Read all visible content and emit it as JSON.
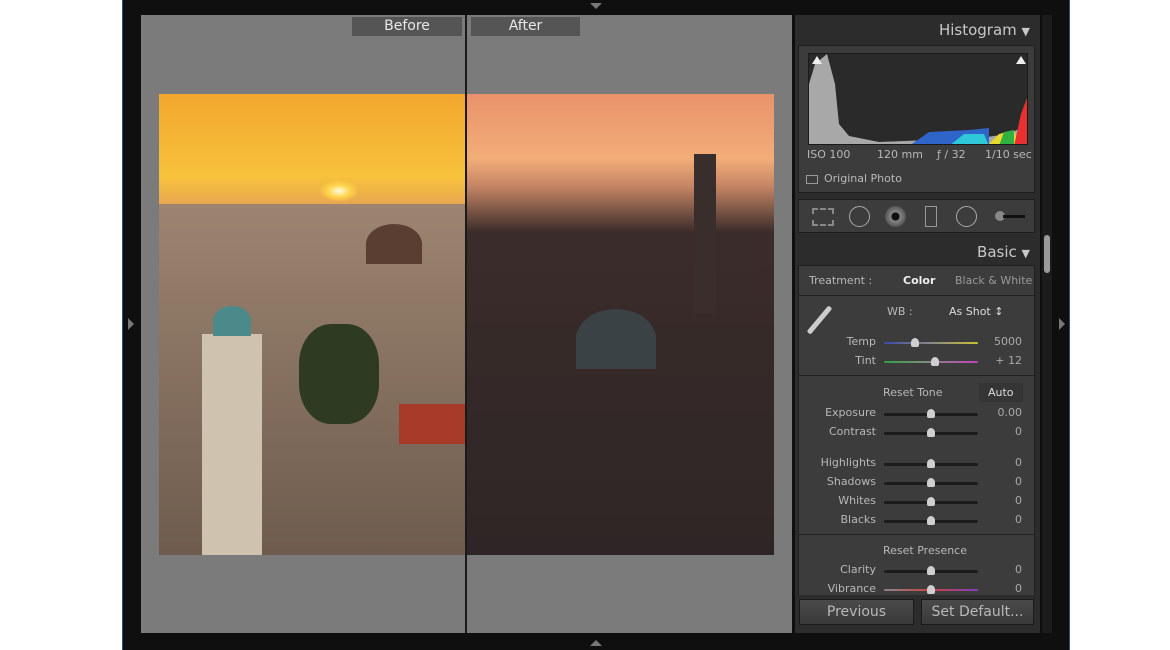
{
  "compare": {
    "before_label": "Before",
    "after_label": "After"
  },
  "histogram": {
    "title": "Histogram",
    "iso": "ISO 100",
    "focal": "120 mm",
    "aperture": "ƒ / 32",
    "shutter": "1/10 sec",
    "original_photo_label": "Original Photo",
    "original_photo_checked": false
  },
  "tools": [
    "crop-overlay",
    "spot-removal",
    "red-eye",
    "graduated-filter",
    "radial-filter",
    "adjustment-brush"
  ],
  "basic": {
    "title": "Basic",
    "treatment_label": "Treatment :",
    "treatment_color": "Color",
    "treatment_bw": "Black & White",
    "wb_label": "WB :",
    "wb_value": "As Shot ↕",
    "reset_tone": "Reset Tone",
    "auto": "Auto",
    "reset_presence": "Reset Presence",
    "sliders": [
      {
        "name": "Temp",
        "value": "5000",
        "pos": 0.33
      },
      {
        "name": "Tint",
        "value": "+ 12",
        "pos": 0.54
      },
      {
        "name": "Exposure",
        "value": "0.00",
        "pos": 0.5
      },
      {
        "name": "Contrast",
        "value": "0",
        "pos": 0.5
      },
      {
        "name": "Highlights",
        "value": "0",
        "pos": 0.5
      },
      {
        "name": "Shadows",
        "value": "0",
        "pos": 0.5
      },
      {
        "name": "Whites",
        "value": "0",
        "pos": 0.5
      },
      {
        "name": "Blacks",
        "value": "0",
        "pos": 0.5
      },
      {
        "name": "Clarity",
        "value": "0",
        "pos": 0.5
      },
      {
        "name": "Vibrance",
        "value": "0",
        "pos": 0.5
      }
    ]
  },
  "buttons": {
    "previous": "Previous",
    "set_default": "Set Default..."
  }
}
